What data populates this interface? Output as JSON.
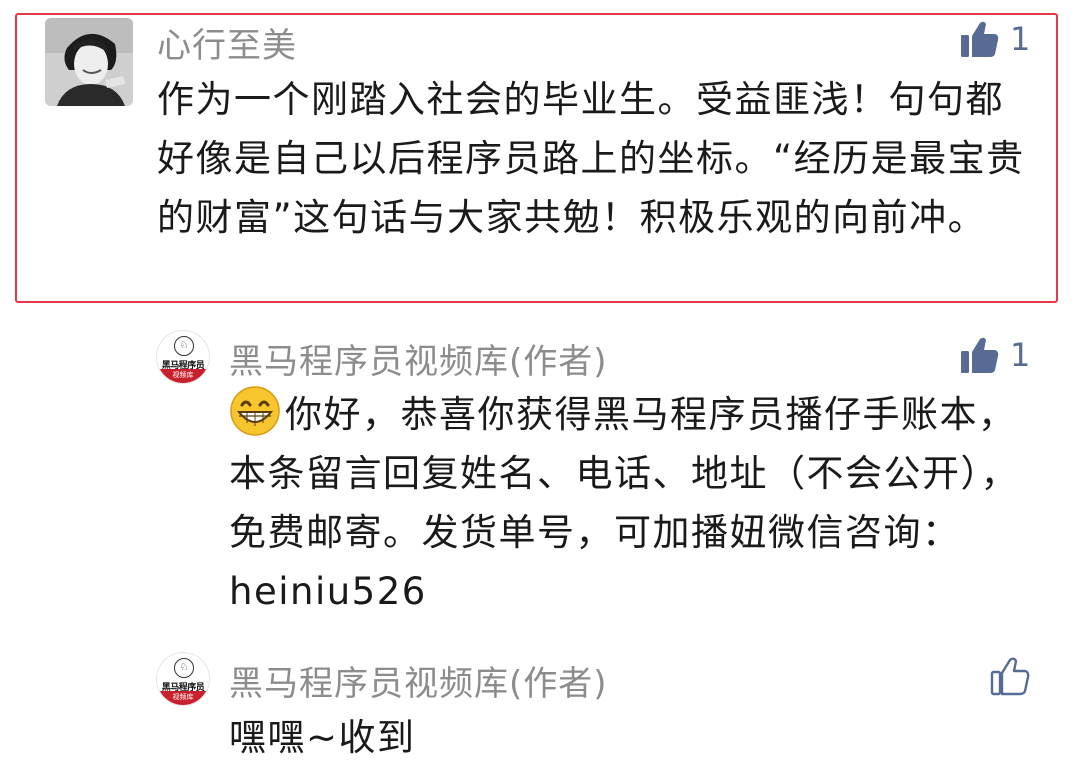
{
  "comment": {
    "nickname": "心行至美",
    "text": "作为一个刚踏入社会的毕业生。受益匪浅！句句都好像是自己以后程序员路上的坐标。“经历是最宝贵的财富”这句话与大家共勉！积极乐观的向前冲。",
    "like_count": "1",
    "highlight_color": "#e5394a"
  },
  "replies": [
    {
      "nickname": "黑马程序员视频库(作者)",
      "avatar_text": "黑马程序员",
      "avatar_band": "视频库",
      "text": "你好，恭喜你获得黑马程序员播仔手账本，本条留言回复姓名、电话、地址（不会公开），免费邮寄。发货单号，可加播妞微信咨询：heiniu526",
      "emoji": "grinning-face-icon",
      "like_count": "1",
      "liked": true
    },
    {
      "nickname": "黑马程序员视频库(作者)",
      "avatar_text": "黑马程序员",
      "avatar_band": "视频库",
      "text": "嘿嘿~收到",
      "liked": false
    }
  ],
  "colors": {
    "like_active": "#576b95",
    "nickname": "#8c8c8c",
    "text": "#1a1a1a"
  }
}
